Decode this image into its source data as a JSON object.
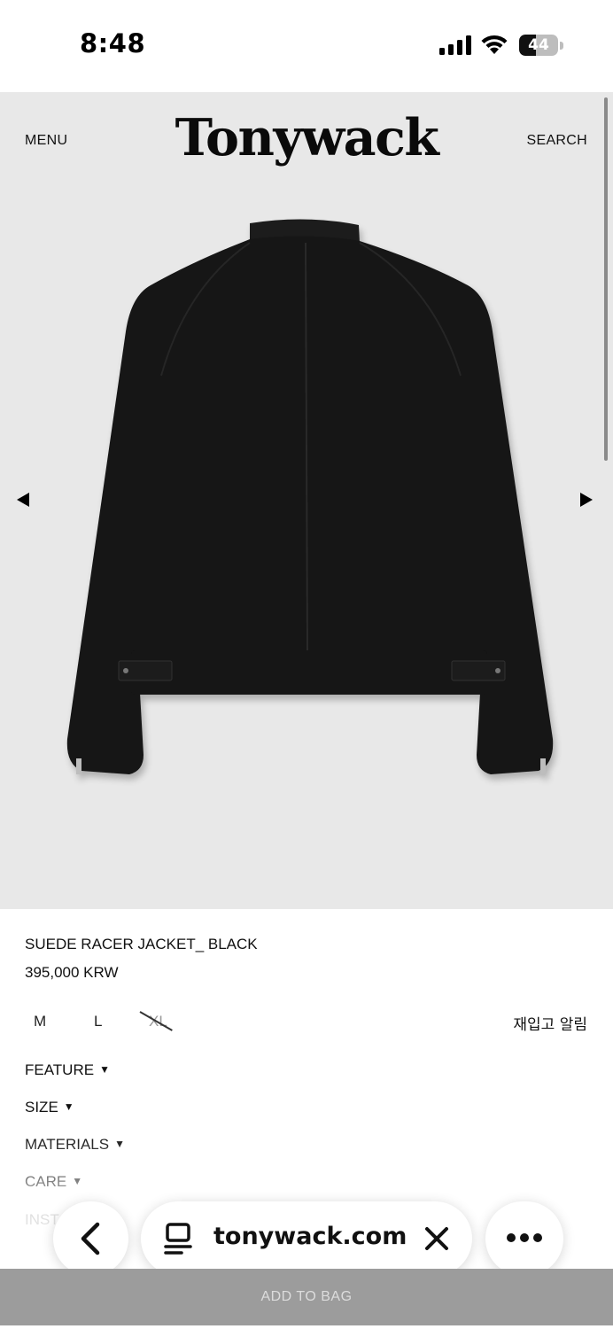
{
  "status_bar": {
    "time": "8:48",
    "battery_level": "44",
    "battery_fraction": 0.44,
    "icons": [
      "signal-icon",
      "wifi-icon",
      "battery-icon"
    ]
  },
  "header": {
    "menu_label": "MENU",
    "brand": "Tonywack",
    "search_label": "SEARCH"
  },
  "gallery": {
    "prev_icon": "triangle-left-icon",
    "next_icon": "triangle-right-icon",
    "image_subject": "black suede racer jacket back view"
  },
  "product": {
    "name": "SUEDE RACER JACKET_ BLACK",
    "price": "395,000 KRW",
    "sizes": [
      {
        "label": "M",
        "available": true
      },
      {
        "label": "L",
        "available": true
      },
      {
        "label": "XL",
        "available": false
      }
    ],
    "restock_label": "재입고 알림"
  },
  "accordion": [
    {
      "label": "FEATURE"
    },
    {
      "label": "SIZE"
    },
    {
      "label": "MATERIALS"
    },
    {
      "label": "CARE"
    },
    {
      "label": "INST"
    }
  ],
  "browser": {
    "url": "tonywack.com",
    "icons": [
      "back-chevron-icon",
      "reader-icon",
      "clear-icon",
      "more-icon"
    ]
  },
  "cta": {
    "add_to_bag": "ADD TO BAG"
  },
  "colors": {
    "hero_bg": "#e8e8e8",
    "cta_bg": "#9c9c9c",
    "cta_text": "#dcdcdc",
    "text": "#111111"
  }
}
